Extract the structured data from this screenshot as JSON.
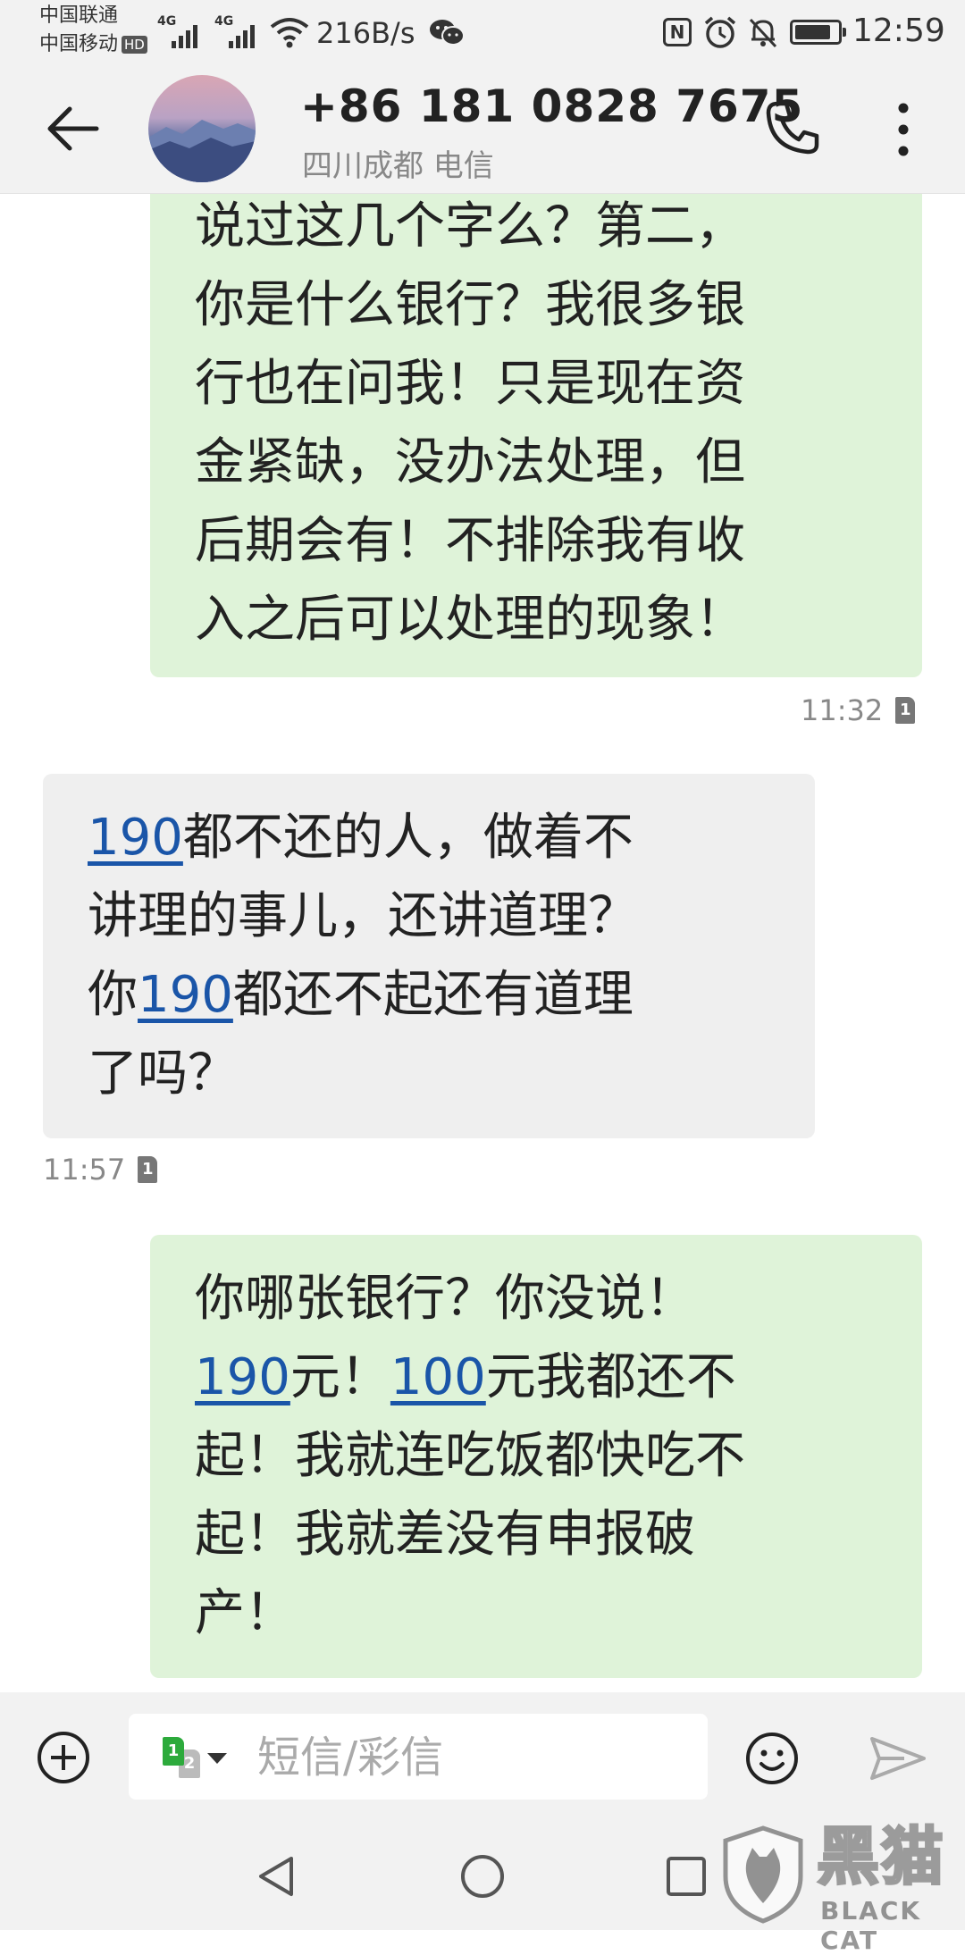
{
  "status_bar": {
    "carrier_1": "中国联通",
    "carrier_2": "中国移动",
    "hd_badge": "HD",
    "net_tag_1": "4G",
    "net_tag_2": "4G",
    "net_speed": "216B/s",
    "nfc_label": "N",
    "time": "12:59",
    "battery_level_pct": 85
  },
  "header": {
    "contact_number": "+86 181 0828 7675",
    "location": "四川成都 电信"
  },
  "messages": [
    {
      "direction": "outgoing",
      "lines": [
        [
          {
            "text": "说过这几个字么？第二，",
            "link": false
          }
        ],
        [
          {
            "text": "你是什么银行？我很多银",
            "link": false
          }
        ],
        [
          {
            "text": "行也在问我！只是现在资",
            "link": false
          }
        ],
        [
          {
            "text": "金紧缺，没办法处理，但",
            "link": false
          }
        ],
        [
          {
            "text": "后期会有！不排除我有收",
            "link": false
          }
        ],
        [
          {
            "text": "入之后可以处理的现象！",
            "link": false
          }
        ]
      ],
      "time": "11:32",
      "sim": "1"
    },
    {
      "direction": "incoming",
      "lines": [
        [
          {
            "text": "190",
            "link": true
          },
          {
            "text": "都不还的人，做着不",
            "link": false
          }
        ],
        [
          {
            "text": "讲理的事儿，还讲道理？",
            "link": false
          }
        ],
        [
          {
            "text": "你",
            "link": false
          },
          {
            "text": "190",
            "link": true
          },
          {
            "text": "都还不起还有道理",
            "link": false
          }
        ],
        [
          {
            "text": "了吗？",
            "link": false
          }
        ]
      ],
      "time": "11:57",
      "sim": "1"
    },
    {
      "direction": "outgoing",
      "lines": [
        [
          {
            "text": "你哪张银行？你没说！",
            "link": false
          }
        ],
        [
          {
            "text": "190",
            "link": true
          },
          {
            "text": "元！",
            "link": false
          },
          {
            "text": "100",
            "link": true
          },
          {
            "text": "元我都还不",
            "link": false
          }
        ],
        [
          {
            "text": "起！我就连吃饭都快吃不",
            "link": false
          }
        ],
        [
          {
            "text": "起！我就差没有申报破",
            "link": false
          }
        ],
        [
          {
            "text": "产！",
            "link": false
          }
        ]
      ]
    }
  ],
  "compose": {
    "placeholder": "短信/彩信",
    "sim_primary": "1",
    "sim_secondary": "2"
  },
  "watermark": {
    "text_cn": "黑猫",
    "text_en": "BLACK CAT"
  }
}
